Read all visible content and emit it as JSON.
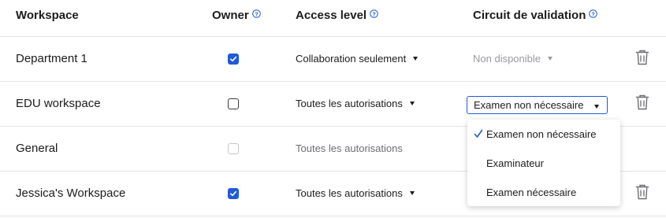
{
  "header": {
    "workspace": "Workspace",
    "owner": "Owner",
    "access_level": "Access level",
    "circuit": "Circuit de validation"
  },
  "rows": [
    {
      "name": "Department 1",
      "owner": "checked",
      "access": "Collaboration seulement",
      "circuit": "Non disponible"
    },
    {
      "name": "EDU workspace",
      "owner": "unchecked",
      "access": "Toutes les autorisations",
      "circuit": "Examen non nécessaire"
    },
    {
      "name": "General",
      "owner": "disabled",
      "access": "Toutes les autorisations",
      "circuit": ""
    },
    {
      "name": "Jessica's Workspace",
      "owner": "checked",
      "access": "Toutes les autorisations",
      "circuit": ""
    }
  ],
  "dropdown": {
    "options": [
      "Examen non nécessaire",
      "Examinateur",
      "Examen nécessaire"
    ],
    "selected_index": 0
  },
  "colors": {
    "accent": "#1f5ad8",
    "divider": "#e3e3e6",
    "muted_text": "#9a9aa0"
  }
}
